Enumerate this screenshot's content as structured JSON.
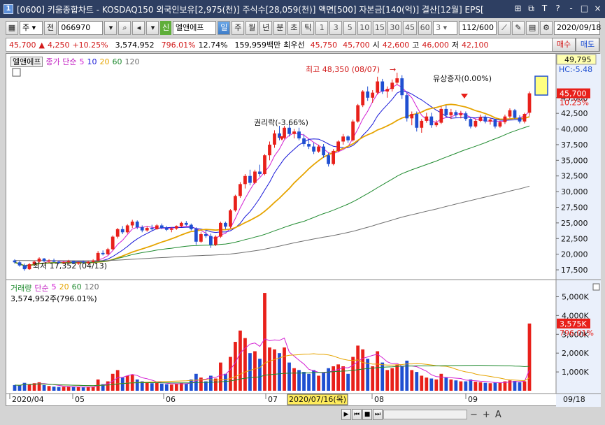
{
  "window": {
    "screen_no": "1",
    "title": "[0600] 키움종합차트 - KOSDAQ150 외국인보유[2,975(천)] 주식수[28,059(천)] 액면[500] 자본금[140(억)] 결산[12월] EPS[",
    "buttons": [
      "⊞",
      "⧉",
      "T",
      "?",
      "-",
      "□",
      "×"
    ]
  },
  "toolbar": {
    "market": "주",
    "prev_label": "전",
    "code": "066970",
    "new_badge": "신",
    "stock_name": "엘앤에프",
    "period_tabs": [
      "일",
      "주",
      "월",
      "년",
      "분",
      "초",
      "틱"
    ],
    "active_tab": "일",
    "intervals": [
      "1",
      "3",
      "5",
      "10",
      "15",
      "30",
      "45",
      "60"
    ],
    "interval_value": "3",
    "count": "112/600",
    "date": "2020/09/18"
  },
  "quote": {
    "price": "45,700",
    "change": "4,250",
    "change_pct": "+10.25%",
    "volume": "3,574,952",
    "vol_ratio": "796.01%",
    "turnover": "12.74%",
    "amount": "159,959백만",
    "best_label": "최우선",
    "ask": "45,750",
    "bid": "45,700",
    "open_label": "시",
    "open": "42,600",
    "high_label": "고",
    "high": "46,000",
    "low_label": "저",
    "low": "42,100",
    "buy": "매수",
    "sell": "매도"
  },
  "price_panel": {
    "name": "엘앤에프",
    "indicator": "종가 단순",
    "ma_periods": [
      "5",
      "10",
      "20",
      "60",
      "120"
    ],
    "ma_colors": [
      "#d31fd3",
      "#1717d8",
      "#e6a400",
      "#1e8a2e",
      "#6f6f6f"
    ],
    "annotations": {
      "high": "최고 48,350 (08/07)",
      "low": "최저 17,352 (04/13)",
      "rights": "권리락(-3.66%)",
      "capital": "유상증자(0.00%)"
    },
    "axis_labels": [
      "45,000",
      "42,500",
      "40,000",
      "37,500",
      "35,000",
      "32,500",
      "30,000",
      "27,500",
      "25,000",
      "22,500",
      "20,000",
      "17,500"
    ],
    "tag_top": "49,795",
    "tag_hc": "HC:-5.48",
    "tag_price": "45,700",
    "tag_pct": "10.25%"
  },
  "volume_panel": {
    "name": "거래량",
    "indicator": "단순",
    "ma_periods": [
      "5",
      "20",
      "60",
      "120"
    ],
    "ma_colors": [
      "#d31fd3",
      "#e6a400",
      "#1e8a2e",
      "#6f6f6f"
    ],
    "current": "3,574,952주(796.01%)",
    "axis_labels": [
      "5,000K",
      "4,000K",
      "3,000K",
      "2,000K",
      "1,000K"
    ],
    "tag_vol": "3,575K",
    "tag_pct": "796.01%"
  },
  "date_axis": {
    "labels": [
      "2020/04",
      "05",
      "06",
      "07",
      "08",
      "09"
    ],
    "cursor": "2020/07/16(목)",
    "end": "09/18"
  },
  "scrollbar": {
    "zoom_out": "−",
    "zoom_in": "+",
    "zoom_reset": "A"
  },
  "colors": {
    "up": "#e8201a",
    "down": "#1f4fd1",
    "titlebar": "#2e3f62"
  },
  "chart_data": {
    "type": "candlestick",
    "x_range": [
      "2020/04",
      "2020/09/18"
    ],
    "price_ylim": [
      16500,
      50000
    ],
    "volume_ylim": [
      0,
      5500000
    ],
    "last": {
      "date": "2020/09/18",
      "open": 42600,
      "high": 46000,
      "low": 42100,
      "close": 45700,
      "volume": 3574952
    },
    "candles": [
      [
        19000,
        19200,
        18500,
        18700,
        300000
      ],
      [
        18700,
        18900,
        18000,
        18200,
        280000
      ],
      [
        18200,
        18500,
        17352,
        17600,
        420000
      ],
      [
        17600,
        18600,
        17500,
        18400,
        350000
      ],
      [
        18400,
        19000,
        18200,
        18800,
        400000
      ],
      [
        18800,
        19500,
        18600,
        19300,
        450000
      ],
      [
        19300,
        19400,
        18700,
        18900,
        300000
      ],
      [
        18900,
        19200,
        18600,
        19000,
        250000
      ],
      [
        19000,
        19300,
        18700,
        18800,
        220000
      ],
      [
        18800,
        19000,
        18500,
        18600,
        200000
      ],
      [
        18600,
        18900,
        18400,
        18700,
        210000
      ],
      [
        18700,
        19100,
        18500,
        18900,
        230000
      ],
      [
        18900,
        19000,
        18400,
        18500,
        200000
      ],
      [
        18500,
        18800,
        18300,
        18700,
        190000
      ],
      [
        18700,
        19000,
        18500,
        18600,
        180000
      ],
      [
        18600,
        18900,
        18400,
        18800,
        200000
      ],
      [
        18800,
        19200,
        18600,
        19000,
        220000
      ],
      [
        19000,
        20500,
        18900,
        20200,
        600000
      ],
      [
        20200,
        20600,
        19800,
        20000,
        350000
      ],
      [
        20000,
        21000,
        19900,
        20800,
        500000
      ],
      [
        20800,
        23000,
        20600,
        22800,
        900000
      ],
      [
        22800,
        24200,
        22500,
        24000,
        1100000
      ],
      [
        24000,
        24500,
        23200,
        23500,
        700000
      ],
      [
        23500,
        24800,
        23300,
        24600,
        800000
      ],
      [
        24600,
        25500,
        24200,
        25200,
        850000
      ],
      [
        25200,
        25400,
        24000,
        24300,
        600000
      ],
      [
        24300,
        24600,
        23500,
        23800,
        500000
      ],
      [
        23800,
        24500,
        23600,
        24200,
        450000
      ],
      [
        24200,
        24700,
        23800,
        24000,
        400000
      ],
      [
        24000,
        24800,
        23900,
        24600,
        420000
      ],
      [
        24600,
        24900,
        24000,
        24200,
        380000
      ],
      [
        24200,
        24500,
        23700,
        23900,
        350000
      ],
      [
        23900,
        24300,
        23500,
        24100,
        330000
      ],
      [
        24100,
        24600,
        23900,
        24500,
        360000
      ],
      [
        24500,
        25200,
        24300,
        25000,
        420000
      ],
      [
        25000,
        25300,
        24500,
        24700,
        380000
      ],
      [
        24700,
        24900,
        23800,
        24000,
        600000
      ],
      [
        24000,
        24300,
        21500,
        22000,
        900000
      ],
      [
        22000,
        23500,
        21800,
        23200,
        700000
      ],
      [
        23200,
        23800,
        22600,
        22900,
        500000
      ],
      [
        22900,
        23300,
        21000,
        21500,
        800000
      ],
      [
        21500,
        23000,
        21300,
        22800,
        650000
      ],
      [
        22800,
        25200,
        22600,
        25000,
        1500000
      ],
      [
        25000,
        25200,
        24000,
        24400,
        900000
      ],
      [
        24400,
        27200,
        24200,
        27000,
        1800000
      ],
      [
        27000,
        29500,
        26800,
        29300,
        2600000
      ],
      [
        29300,
        31500,
        29000,
        31200,
        3200000
      ],
      [
        31200,
        32800,
        30500,
        32500,
        2800000
      ],
      [
        32500,
        33500,
        31000,
        31400,
        2000000
      ],
      [
        31400,
        33500,
        31200,
        33200,
        2100000
      ],
      [
        33200,
        34300,
        32400,
        32800,
        1700000
      ],
      [
        32800,
        36000,
        32600,
        35800,
        5200000
      ],
      [
        35800,
        38000,
        35000,
        37500,
        2300000
      ],
      [
        37500,
        39800,
        37000,
        39300,
        2200000
      ],
      [
        39300,
        40500,
        38200,
        38600,
        2000000
      ],
      [
        38600,
        40500,
        38400,
        40200,
        2300000
      ],
      [
        40200,
        40800,
        38800,
        39200,
        1500000
      ],
      [
        39200,
        40000,
        38500,
        39600,
        1200000
      ],
      [
        39600,
        40200,
        38200,
        38500,
        1100000
      ],
      [
        38500,
        39200,
        37200,
        37600,
        1000000
      ],
      [
        37600,
        38300,
        36800,
        37200,
        900000
      ],
      [
        37200,
        37800,
        36000,
        36400,
        1100000
      ],
      [
        36400,
        37500,
        36200,
        37200,
        800000
      ],
      [
        37200,
        37600,
        35400,
        35800,
        950000
      ],
      [
        35800,
        36200,
        34000,
        34400,
        1200000
      ],
      [
        34400,
        36800,
        34200,
        36500,
        1300000
      ],
      [
        36500,
        38200,
        36300,
        38000,
        1400000
      ],
      [
        38000,
        39200,
        37500,
        38800,
        1300000
      ],
      [
        38800,
        39000,
        37800,
        38200,
        900000
      ],
      [
        38200,
        41500,
        38000,
        41200,
        1800000
      ],
      [
        41200,
        44000,
        41000,
        43800,
        2400000
      ],
      [
        43800,
        46200,
        43500,
        46000,
        2200000
      ],
      [
        46000,
        46800,
        44500,
        45000,
        1700000
      ],
      [
        45000,
        46200,
        44200,
        45800,
        1300000
      ],
      [
        45800,
        48350,
        45500,
        47600,
        2100000
      ],
      [
        47600,
        48000,
        45600,
        46000,
        1500000
      ],
      [
        46000,
        46800,
        45000,
        46400,
        1100000
      ],
      [
        46400,
        47900,
        46000,
        47400,
        1200000
      ],
      [
        47400,
        49000,
        47000,
        48100,
        1400000
      ],
      [
        48100,
        48600,
        44800,
        45400,
        1300000
      ],
      [
        45400,
        45800,
        41200,
        41700,
        1600000
      ],
      [
        41700,
        42800,
        40600,
        42400,
        1100000
      ],
      [
        42400,
        42800,
        39600,
        40200,
        1000000
      ],
      [
        40200,
        41600,
        39400,
        41300,
        800000
      ],
      [
        41300,
        42600,
        41000,
        42000,
        700000
      ],
      [
        42000,
        42600,
        40200,
        40600,
        650000
      ],
      [
        40600,
        41400,
        40300,
        41000,
        600000
      ],
      [
        41000,
        43600,
        40800,
        43200,
        900000
      ],
      [
        43200,
        43800,
        41800,
        42200,
        700000
      ],
      [
        42200,
        43200,
        41600,
        42700,
        600000
      ],
      [
        42700,
        43000,
        41900,
        42200,
        550000
      ],
      [
        42200,
        42900,
        41700,
        42500,
        500000
      ],
      [
        42500,
        42800,
        41300,
        41600,
        500000
      ],
      [
        41600,
        41900,
        40100,
        40400,
        600000
      ],
      [
        40400,
        41600,
        40200,
        41300,
        480000
      ],
      [
        41300,
        42300,
        41100,
        41900,
        450000
      ],
      [
        41900,
        42200,
        40900,
        41200,
        420000
      ],
      [
        41200,
        41700,
        40700,
        41500,
        400000
      ],
      [
        41500,
        41600,
        40100,
        40400,
        450000
      ],
      [
        40400,
        41300,
        40200,
        41100,
        420000
      ],
      [
        41100,
        42300,
        40800,
        42000,
        500000
      ],
      [
        42000,
        43300,
        41700,
        43000,
        550000
      ],
      [
        43000,
        43200,
        41600,
        41800,
        520000
      ],
      [
        41800,
        42200,
        40900,
        41200,
        450000
      ],
      [
        41200,
        42600,
        40900,
        42400,
        500000
      ],
      [
        42600,
        46000,
        42100,
        45700,
        3574952
      ]
    ]
  }
}
